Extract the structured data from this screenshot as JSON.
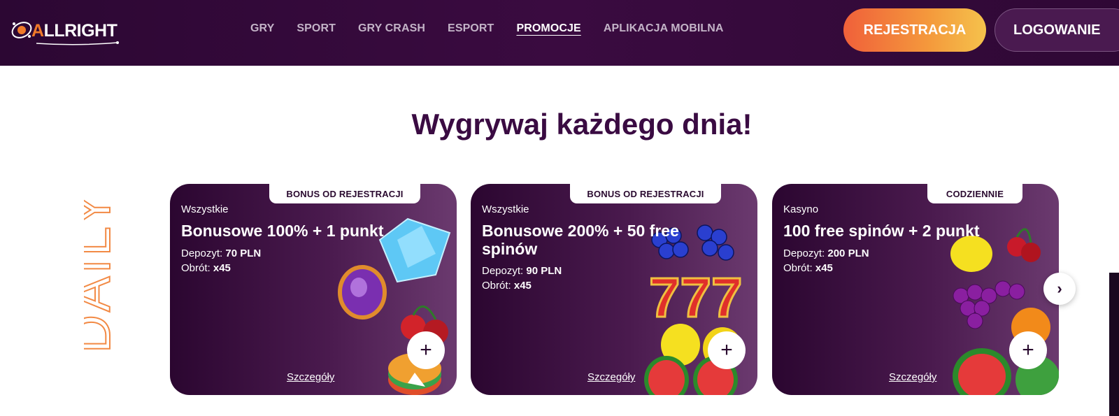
{
  "header": {
    "logo_text": "ALLRIGHT",
    "nav": [
      "GRY",
      "SPORT",
      "GRY CRASH",
      "ESPORT",
      "PROMOCJE",
      "APLIKACJA MOBILNA"
    ],
    "active_nav": "PROMOCJE",
    "register_label": "REJESTRACJA",
    "login_label": "LOGOWANIE"
  },
  "main": {
    "title": "Wygrywaj każdego dnia!",
    "side_label": "DAILY",
    "cards": [
      {
        "tag": "BONUS OD REJESTRACJI",
        "category": "Wszystkie",
        "name": "Bonusowe 100% + 1 punkt",
        "deposit_label": "Depozyt:",
        "deposit_value": "70 PLN",
        "turnover_label": "Obrót:",
        "turnover_value": "x45",
        "details": "Szczegóły"
      },
      {
        "tag": "BONUS OD REJESTRACJI",
        "category": "Wszystkie",
        "name": "Bonusowe 200% + 50 free spinów",
        "deposit_label": "Depozyt:",
        "deposit_value": "90 PLN",
        "turnover_label": "Obrót:",
        "turnover_value": "x45",
        "details": "Szczegóły"
      },
      {
        "tag": "CODZIENNIE",
        "category": "Kasyno",
        "name": "100 free spinów + 2 punkt",
        "deposit_label": "Depozyt:",
        "deposit_value": "200 PLN",
        "turnover_label": "Obrót:",
        "turnover_value": "x45",
        "details": "Szczegóły"
      }
    ]
  },
  "icons": {
    "plus": "+",
    "next": "›",
    "plus_icon": "plus-icon",
    "next_icon": "chevron-right-icon"
  },
  "colors": {
    "header_bg": "#2c0733",
    "title": "#3a0b42",
    "register_gradient_start": "#f0603a",
    "register_gradient_end": "#f5c24c",
    "daily_outline": "#f28a45"
  }
}
